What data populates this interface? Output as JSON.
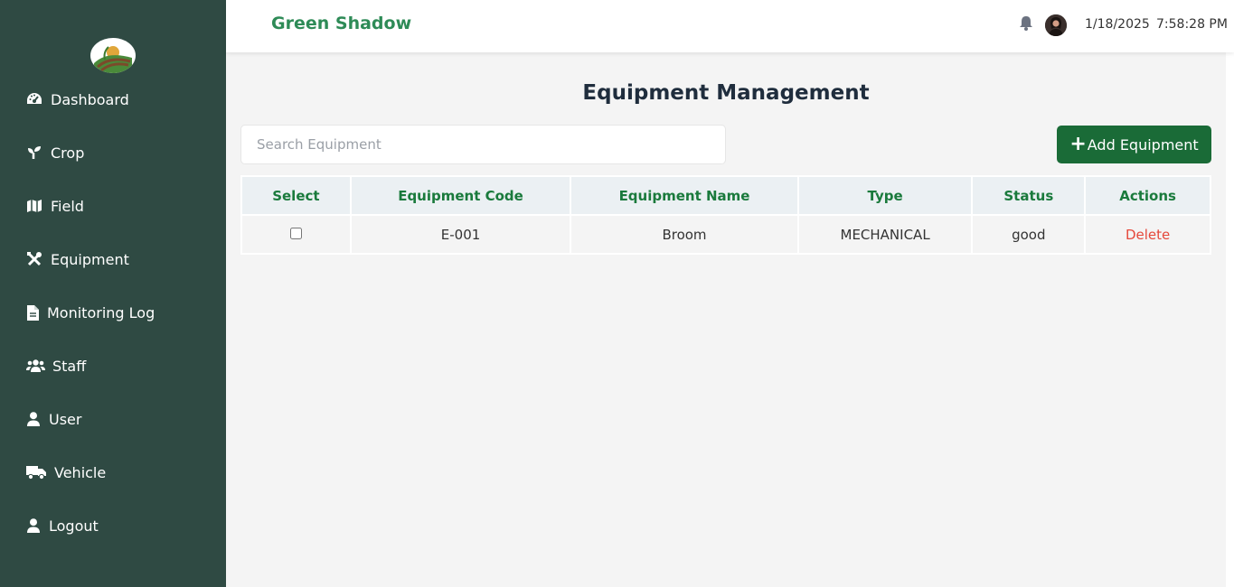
{
  "colors": {
    "sidebar_bg": "#2f4a43",
    "brand": "#2e8b57",
    "primary_button": "#1a6b37",
    "table_header_text": "#1a7a3c",
    "delete": "#e5483b"
  },
  "header": {
    "brand": "Green Shadow",
    "date": "1/18/2025",
    "time": "7:58:28 PM",
    "bell_icon": "bell-icon",
    "avatar": "user-avatar"
  },
  "sidebar": {
    "items": [
      {
        "label": "Dashboard",
        "icon": "gauge-icon"
      },
      {
        "label": "Crop",
        "icon": "seedling-icon"
      },
      {
        "label": "Field",
        "icon": "map-icon"
      },
      {
        "label": "Equipment",
        "icon": "tools-icon"
      },
      {
        "label": "Monitoring Log",
        "icon": "file-icon"
      },
      {
        "label": "Staff",
        "icon": "users-icon"
      },
      {
        "label": "User",
        "icon": "user-icon"
      },
      {
        "label": "Vehicle",
        "icon": "truck-icon"
      },
      {
        "label": "Logout",
        "icon": "user-icon"
      }
    ]
  },
  "main": {
    "title": "Equipment Management",
    "search_placeholder": "Search Equipment",
    "search_value": "",
    "add_button_label": "Add Equipment",
    "table": {
      "headers": [
        "Select",
        "Equipment Code",
        "Equipment Name",
        "Type",
        "Status",
        "Actions"
      ],
      "rows": [
        {
          "selected": false,
          "code": "E-001",
          "name": "Broom",
          "type": "MECHANICAL",
          "status": "good",
          "action": "Delete"
        }
      ]
    }
  }
}
